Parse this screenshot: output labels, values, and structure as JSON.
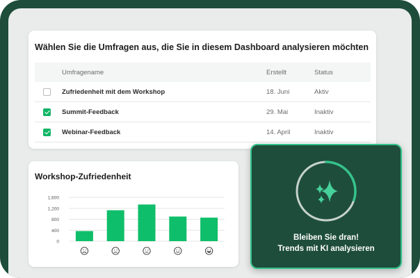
{
  "survey_panel": {
    "title": "Wählen Sie die Umfragen aus, die Sie in diesem Dashboard analysieren möchten",
    "columns": {
      "name": "Umfragename",
      "created": "Erstellt",
      "status": "Status"
    },
    "rows": [
      {
        "name": "Zufriedenheit mit dem Workshop",
        "created": "18. Juni",
        "status": "Aktiv",
        "checked": false
      },
      {
        "name": "Summit-Feedback",
        "created": "29. Mai",
        "status": "Inaktiv",
        "checked": true
      },
      {
        "name": "Webinar-Feedback",
        "created": "14. April",
        "status": "Inaktiv",
        "checked": true
      }
    ]
  },
  "chart_panel": {
    "title": "Workshop-Zufriedenheit"
  },
  "chart_data": {
    "type": "bar",
    "title": "Workshop-Zufriedenheit",
    "categories": [
      "very-dissatisfied-face",
      "dissatisfied-face",
      "neutral-face",
      "satisfied-face",
      "very-satisfied-face"
    ],
    "values": [
      370,
      1130,
      1340,
      900,
      860
    ],
    "yticks": [
      "0",
      "400",
      "800",
      "1,200",
      "1,600"
    ],
    "ylim": [
      0,
      1600
    ],
    "color": "#0fbe6a",
    "grid": true
  },
  "ai_panel": {
    "line1": "Bleiben Sie dran!",
    "line2": "Trends mit KI analysieren",
    "ring_progress": 0.3
  },
  "colors": {
    "brand_dark": "#1e4d3c",
    "accent": "#10b565",
    "accent_light": "#34c28a"
  }
}
